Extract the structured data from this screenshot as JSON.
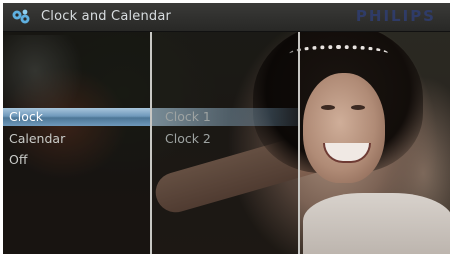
{
  "title_bar": {
    "title": "Clock and Calendar",
    "brand": "PHILIPS",
    "icon": "settings-gears-icon"
  },
  "menu": {
    "level1": [
      {
        "label": "Clock",
        "selected": true
      },
      {
        "label": "Calendar",
        "selected": false
      },
      {
        "label": "Off",
        "selected": false
      }
    ],
    "level2": [
      {
        "label": "Clock 1",
        "selected": true
      },
      {
        "label": "Clock 2",
        "selected": false
      }
    ]
  },
  "colors": {
    "selection_highlight": "#6f99bb",
    "brand": "#2f3d6e",
    "divider": "#c8c8c4"
  }
}
